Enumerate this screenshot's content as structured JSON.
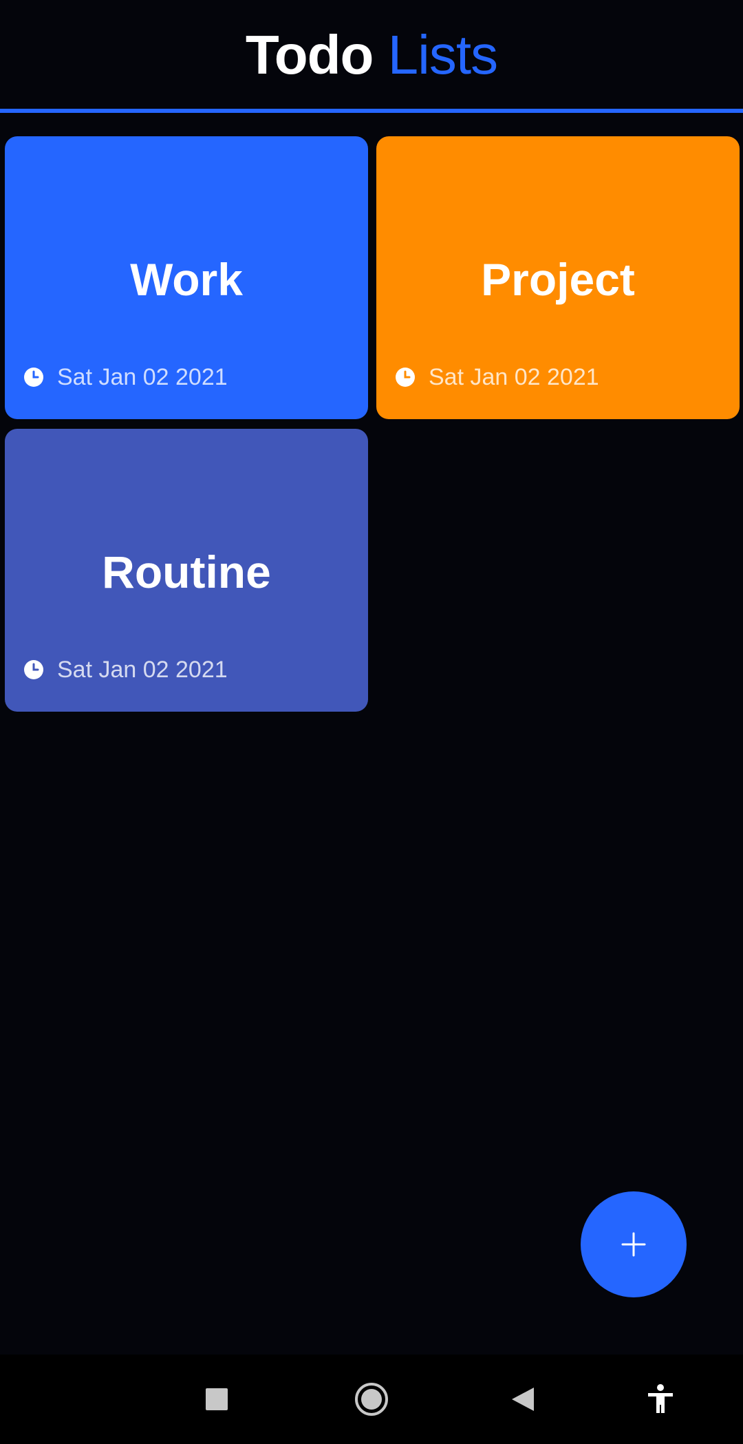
{
  "header": {
    "title_part1": "Todo",
    "title_part2": "Lists",
    "accent_color": "#2566ff"
  },
  "cards": [
    {
      "title": "Work",
      "date": "Sat Jan 02 2021",
      "color": "#2566ff",
      "icon": "clock-icon"
    },
    {
      "title": "Project",
      "date": "Sat Jan 02 2021",
      "color": "#ff8c00",
      "icon": "clock-icon"
    },
    {
      "title": "Routine",
      "date": "Sat Jan 02 2021",
      "color": "#4157b9",
      "icon": "clock-icon"
    }
  ],
  "fab": {
    "icon": "plus-icon",
    "color": "#2566ff"
  },
  "nav_bar": {
    "items": [
      {
        "icon": "recents-square-icon"
      },
      {
        "icon": "home-circle-icon"
      },
      {
        "icon": "back-triangle-icon"
      },
      {
        "icon": "accessibility-icon"
      }
    ]
  }
}
